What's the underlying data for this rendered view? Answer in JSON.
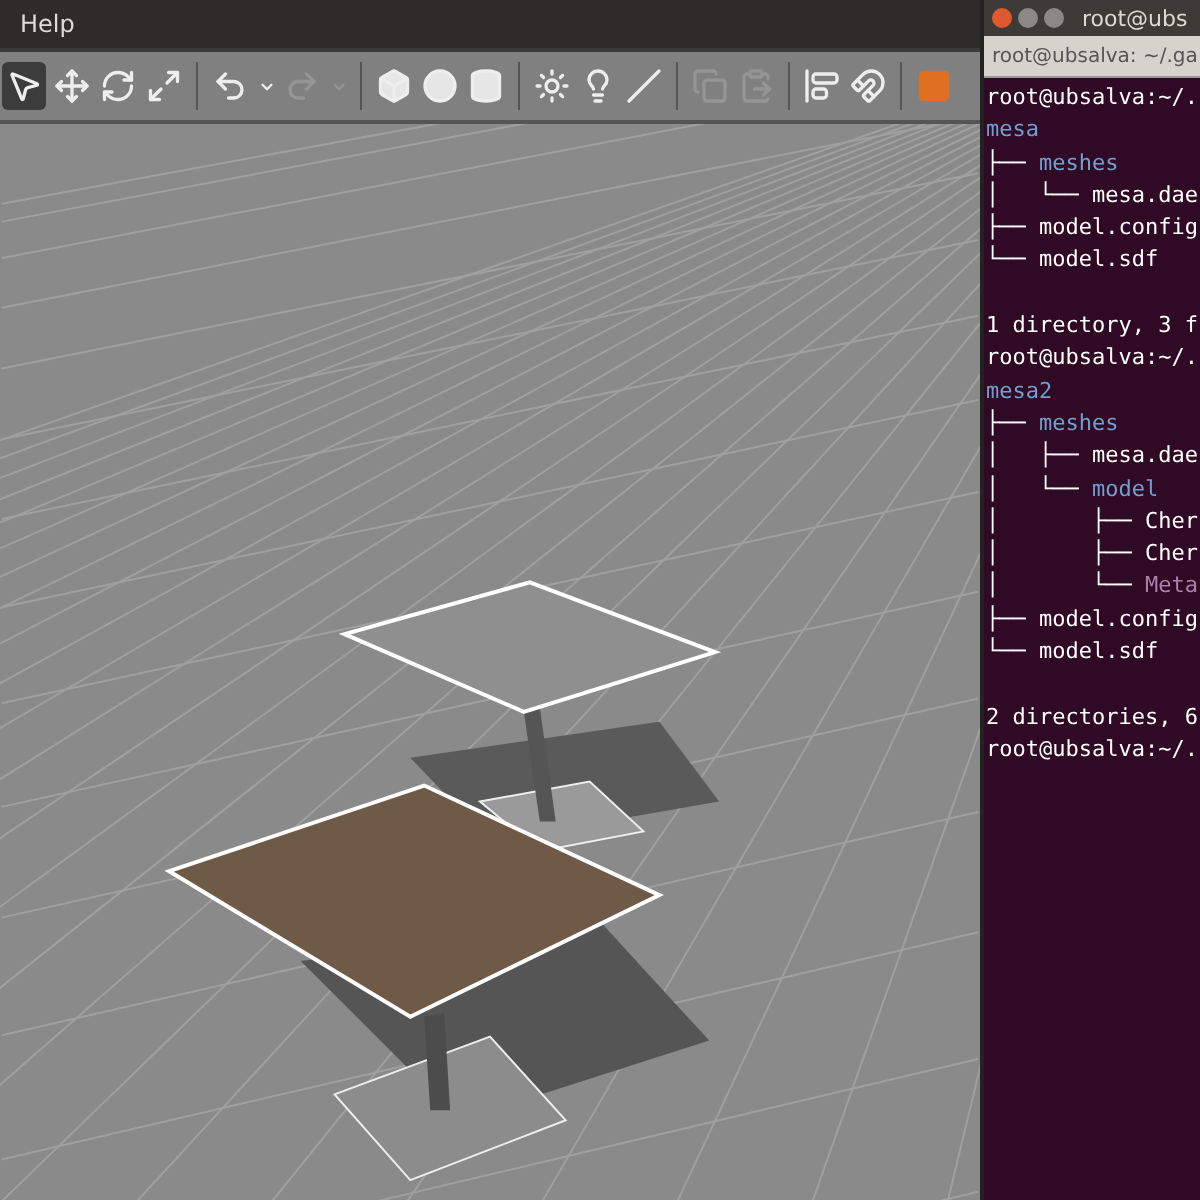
{
  "menu": [
    {
      "label": "Help"
    }
  ],
  "toolbar": [
    {
      "kind": "select",
      "selected": true
    },
    {
      "kind": "translate",
      "selected": false
    },
    {
      "kind": "rotate",
      "selected": false
    },
    {
      "kind": "scale",
      "selected": false
    },
    {
      "kind": "separator"
    },
    {
      "kind": "undo",
      "disabled": false
    },
    {
      "kind": "dropdown",
      "disabled": false
    },
    {
      "kind": "redo",
      "disabled": true
    },
    {
      "kind": "dropdown",
      "disabled": true
    },
    {
      "kind": "separator"
    },
    {
      "kind": "box"
    },
    {
      "kind": "sphere"
    },
    {
      "kind": "cylinder"
    },
    {
      "kind": "separator"
    },
    {
      "kind": "pointlight"
    },
    {
      "kind": "spotlight"
    },
    {
      "kind": "dirlight"
    },
    {
      "kind": "separator"
    },
    {
      "kind": "copy",
      "disabled": true
    },
    {
      "kind": "paste",
      "disabled": true
    },
    {
      "kind": "separator"
    },
    {
      "kind": "align"
    },
    {
      "kind": "snap"
    },
    {
      "kind": "separator"
    },
    {
      "kind": "record"
    }
  ],
  "terminal": {
    "title": "root@ubs",
    "tab": "root@ubsalva: ~/.ga",
    "lines": [
      {
        "kind": "plain",
        "text": "root@ubsalva:~/."
      },
      {
        "kind": "dir",
        "text": "mesa"
      },
      {
        "kind": "dir",
        "prefix": "├── ",
        "text": "meshes"
      },
      {
        "kind": "file",
        "prefix": "│   └── ",
        "text": "mesa.dae"
      },
      {
        "kind": "file",
        "prefix": "├── ",
        "text": "model.config"
      },
      {
        "kind": "file",
        "prefix": "└── ",
        "text": "model.sdf"
      },
      {
        "kind": "blank"
      },
      {
        "kind": "plain",
        "text": "1 directory, 3 f"
      },
      {
        "kind": "plain",
        "text": "root@ubsalva:~/."
      },
      {
        "kind": "dir",
        "text": "mesa2"
      },
      {
        "kind": "dir",
        "prefix": "├── ",
        "text": "meshes"
      },
      {
        "kind": "file",
        "prefix": "│   ├── ",
        "text": "mesa.dae"
      },
      {
        "kind": "dir",
        "prefix": "│   └── ",
        "text": "model"
      },
      {
        "kind": "file",
        "prefix": "│       ├── ",
        "text": "Cher"
      },
      {
        "kind": "file",
        "prefix": "│       ├── ",
        "text": "Cher"
      },
      {
        "kind": "image",
        "prefix": "│       └── ",
        "text": "Meta"
      },
      {
        "kind": "file",
        "prefix": "├── ",
        "text": "model.config"
      },
      {
        "kind": "file",
        "prefix": "└── ",
        "text": "model.sdf"
      },
      {
        "kind": "blank"
      },
      {
        "kind": "plain",
        "text": "2 directories, 6"
      },
      {
        "kind": "plain",
        "text": "root@ubsalva:~/."
      }
    ]
  }
}
